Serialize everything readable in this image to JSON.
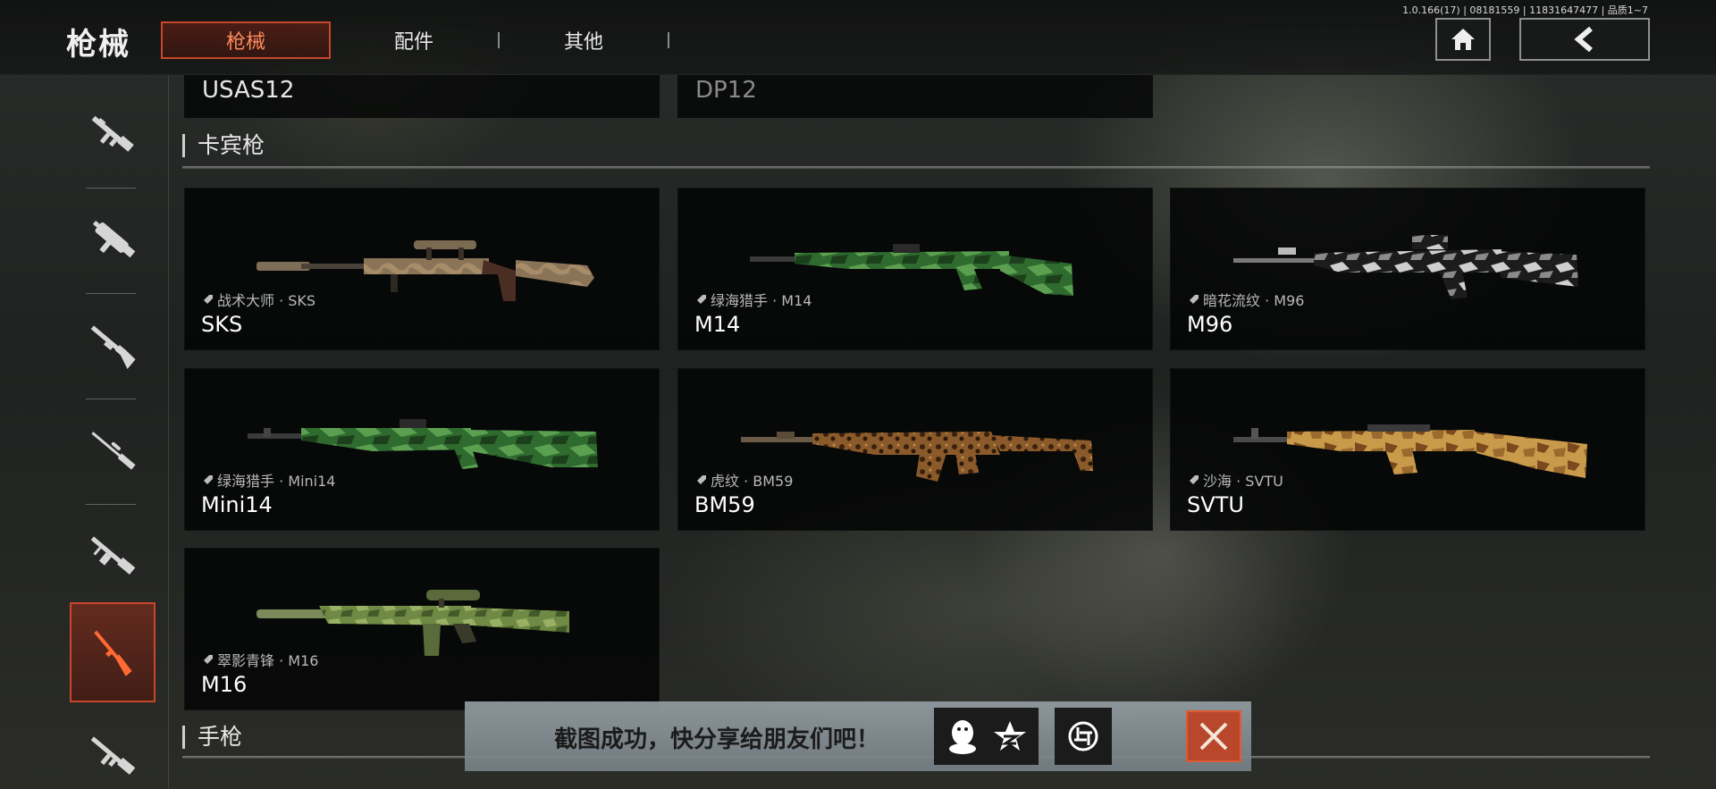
{
  "version": "1.0.166(17) | 08181559 | 11831647477 | 品质1~7",
  "header": {
    "title": "枪械",
    "tabs": [
      {
        "label": "枪械",
        "active": true
      },
      {
        "label": "配件",
        "active": false
      },
      {
        "label": "其他",
        "active": false
      }
    ],
    "home_icon": "home-icon",
    "back_icon": "back-arrow-icon"
  },
  "sidebar": {
    "items": [
      {
        "icon": "assault-rifle-icon",
        "active": false
      },
      {
        "icon": "smg-icon",
        "active": false
      },
      {
        "icon": "shotgun-icon",
        "active": false
      },
      {
        "icon": "sniper-rifle-icon",
        "active": false
      },
      {
        "icon": "lmg-icon",
        "active": false
      },
      {
        "icon": "carbine-icon",
        "active": true
      },
      {
        "icon": "rifle-icon",
        "active": false
      }
    ]
  },
  "prev_section_cards": [
    "USAS12",
    "DP12"
  ],
  "sections": [
    {
      "title": "卡宾枪",
      "weapons": [
        {
          "skin": "战术大师 · SKS",
          "name": "SKS",
          "camo": "tan"
        },
        {
          "skin": "绿海猎手 · M14",
          "name": "M14",
          "camo": "green"
        },
        {
          "skin": "暗花流纹 · M96",
          "name": "M96",
          "camo": "bw"
        },
        {
          "skin": "绿海猎手 · Mini14",
          "name": "Mini14",
          "camo": "green"
        },
        {
          "skin": "虎纹 · BM59",
          "name": "BM59",
          "camo": "leopard"
        },
        {
          "skin": "沙海 · SVTU",
          "name": "SVTU",
          "camo": "sand"
        },
        {
          "skin": "翠影青锋 · M16",
          "name": "M16",
          "camo": "olive"
        }
      ]
    },
    {
      "title": "手枪",
      "weapons": []
    }
  ],
  "toast": {
    "message": "截图成功，快分享给朋友们吧！",
    "share_targets": [
      "qq-icon",
      "qzone-star-icon",
      "wechat-moments-icon"
    ],
    "close_icon": "close-icon"
  },
  "colors": {
    "accent": "#c8472a",
    "accent_text": "#ff8a5c",
    "card_bg": "#040505",
    "toast_bg": "#8e999e"
  }
}
